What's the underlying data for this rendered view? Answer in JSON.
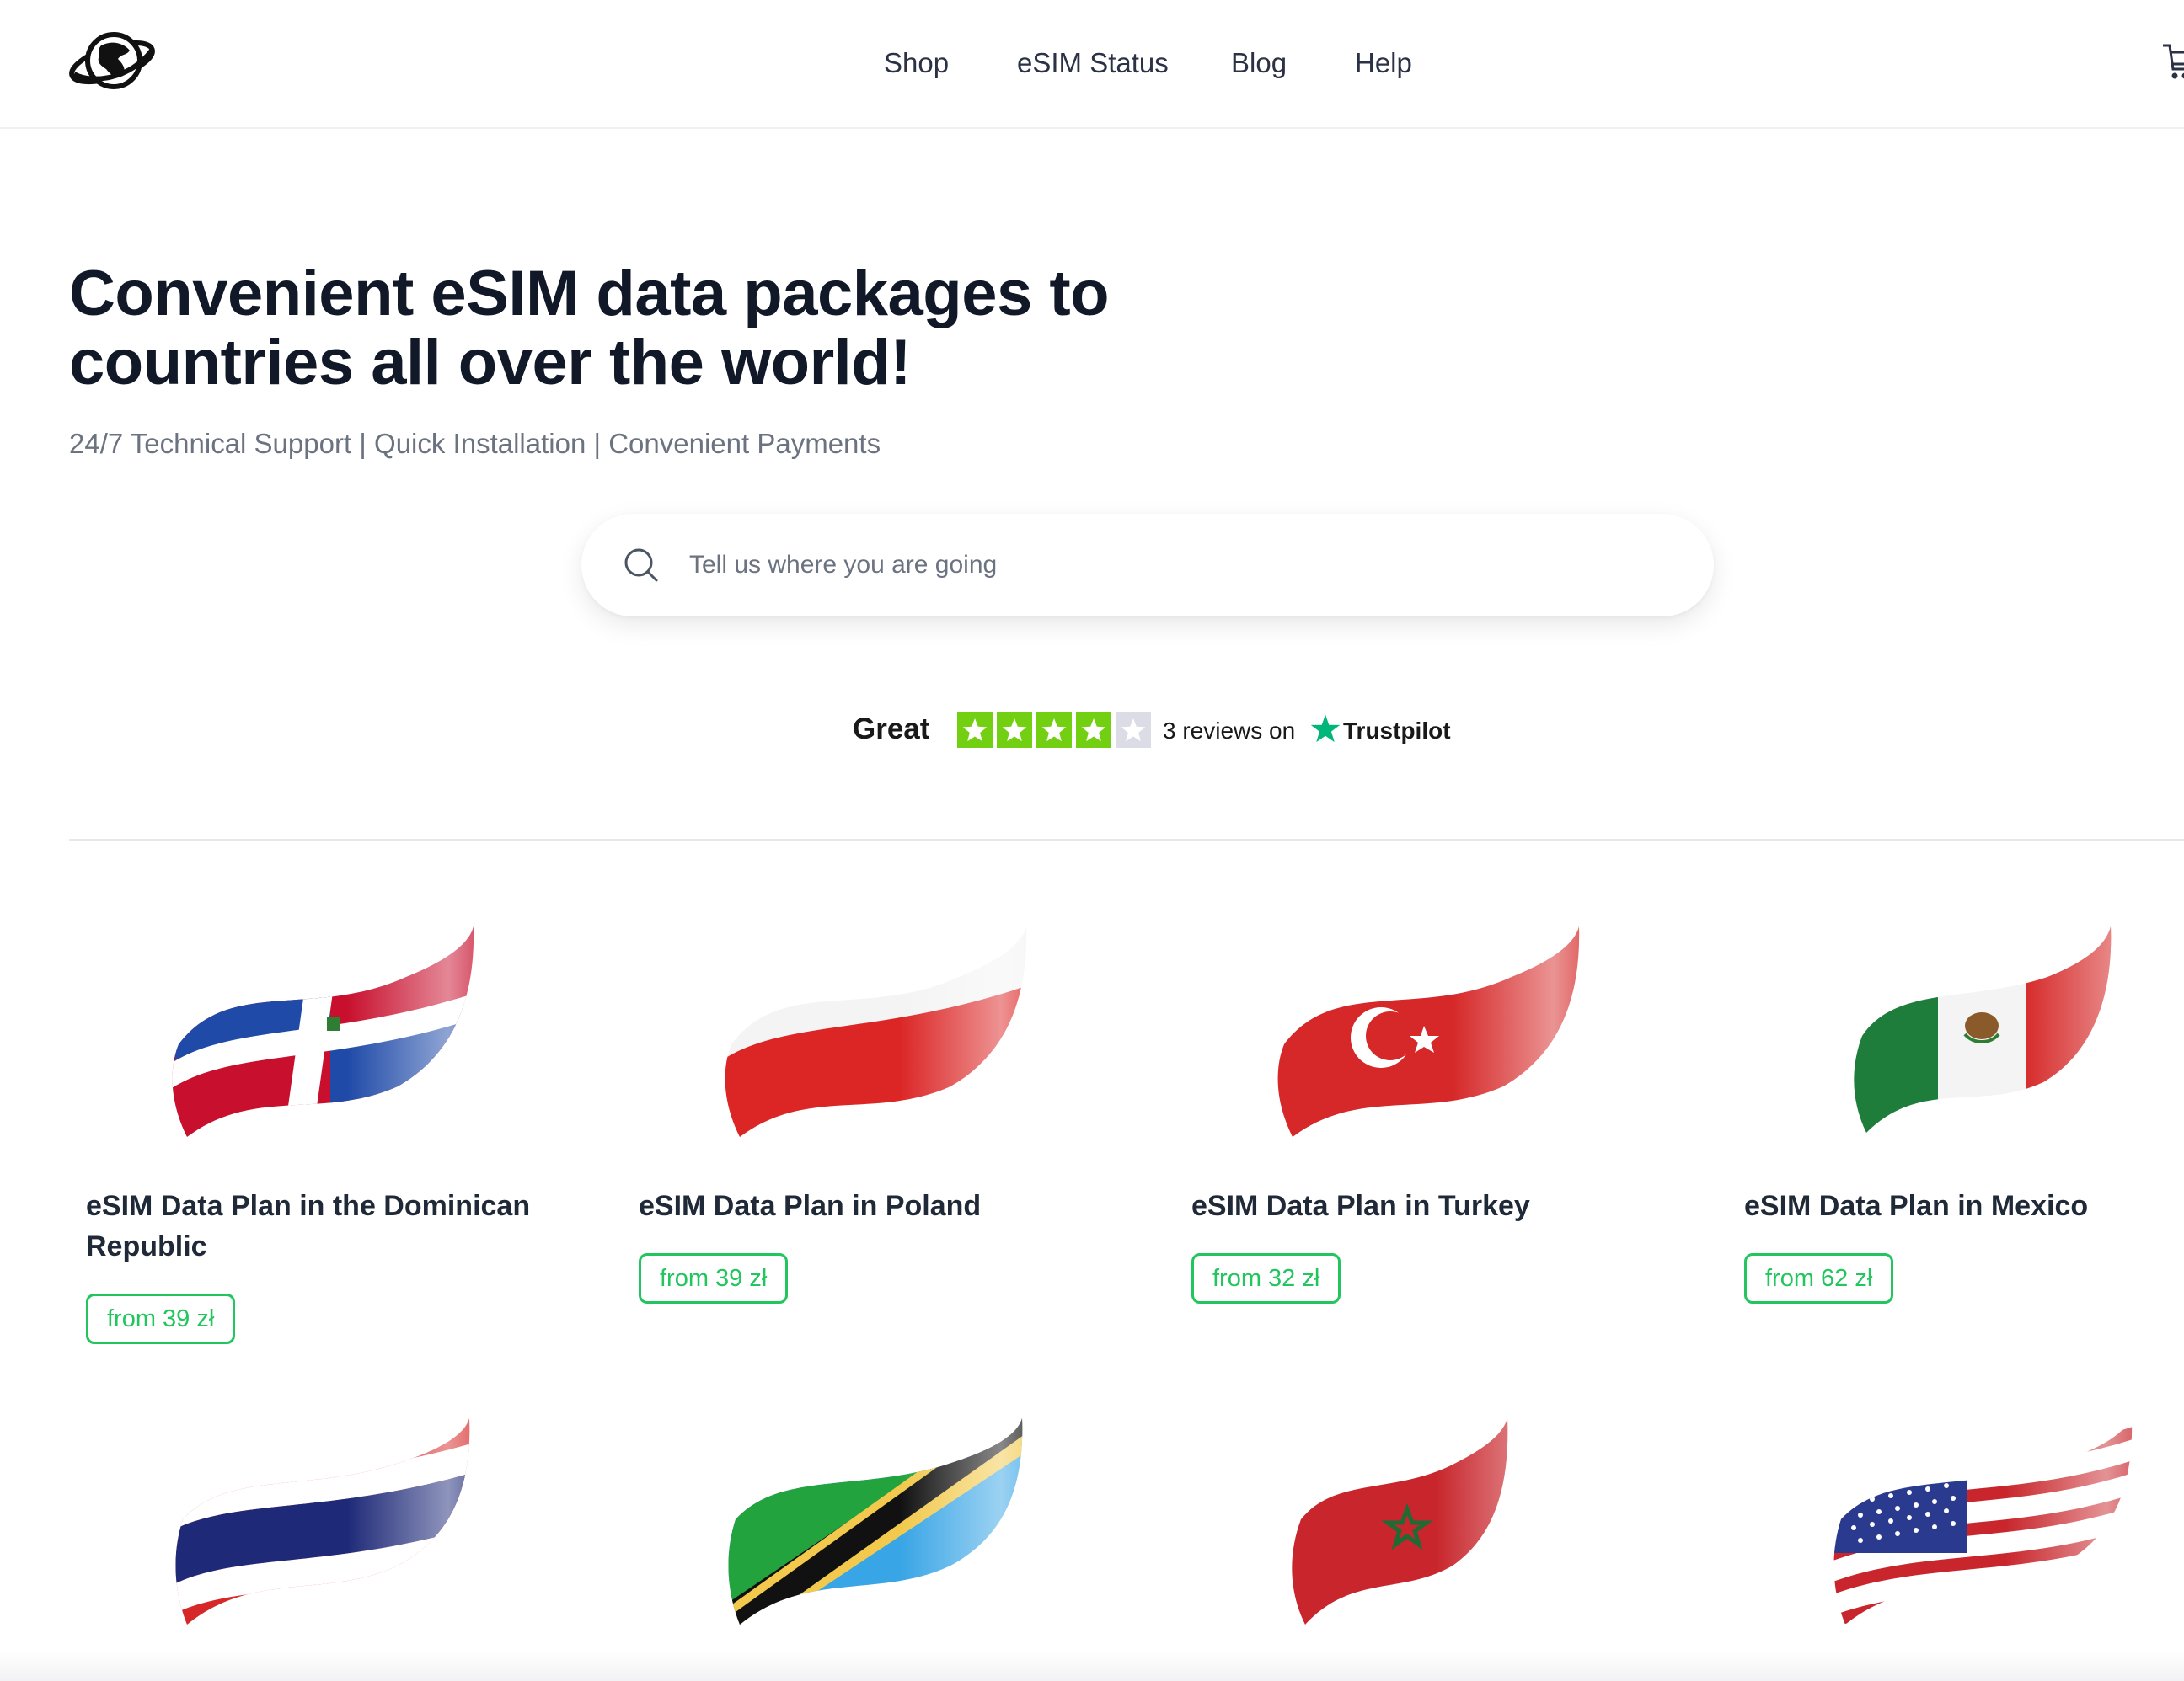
{
  "header": {
    "nav": [
      {
        "label": "Shop"
      },
      {
        "label": "eSIM Status"
      },
      {
        "label": "Blog"
      },
      {
        "label": "Help"
      }
    ]
  },
  "hero": {
    "title": "Convenient eSIM data packages to countries all over the world!",
    "subtitle": "24/7 Technical Support | Quick Installation | Convenient Payments"
  },
  "search": {
    "placeholder": "Tell us where you are going"
  },
  "trustpilot": {
    "rating_text": "Great",
    "stars": 4,
    "max_stars": 5,
    "reviews_text": "3 reviews on",
    "brand": "Trustpilot",
    "star_color": "#73cf11",
    "brand_color": "#00b67a"
  },
  "cards": [
    {
      "title": "eSIM Data Plan in the Dominican Republic",
      "price": "from 39 zł",
      "flag": "dominican-republic-flag"
    },
    {
      "title": "eSIM Data Plan in Poland",
      "price": "from 39 zł",
      "flag": "poland-flag"
    },
    {
      "title": "eSIM Data Plan in Turkey",
      "price": "from 32 zł",
      "flag": "turkey-flag"
    },
    {
      "title": "eSIM Data Plan in Mexico",
      "price": "from 62 zł",
      "flag": "mexico-flag"
    },
    {
      "flag": "thailand-flag"
    },
    {
      "flag": "tanzania-flag"
    },
    {
      "flag": "morocco-flag"
    },
    {
      "flag": "usa-flag"
    }
  ],
  "colors": {
    "accent_green": "#22c55e",
    "text_dark": "#111827",
    "text_muted": "#6b7280"
  }
}
